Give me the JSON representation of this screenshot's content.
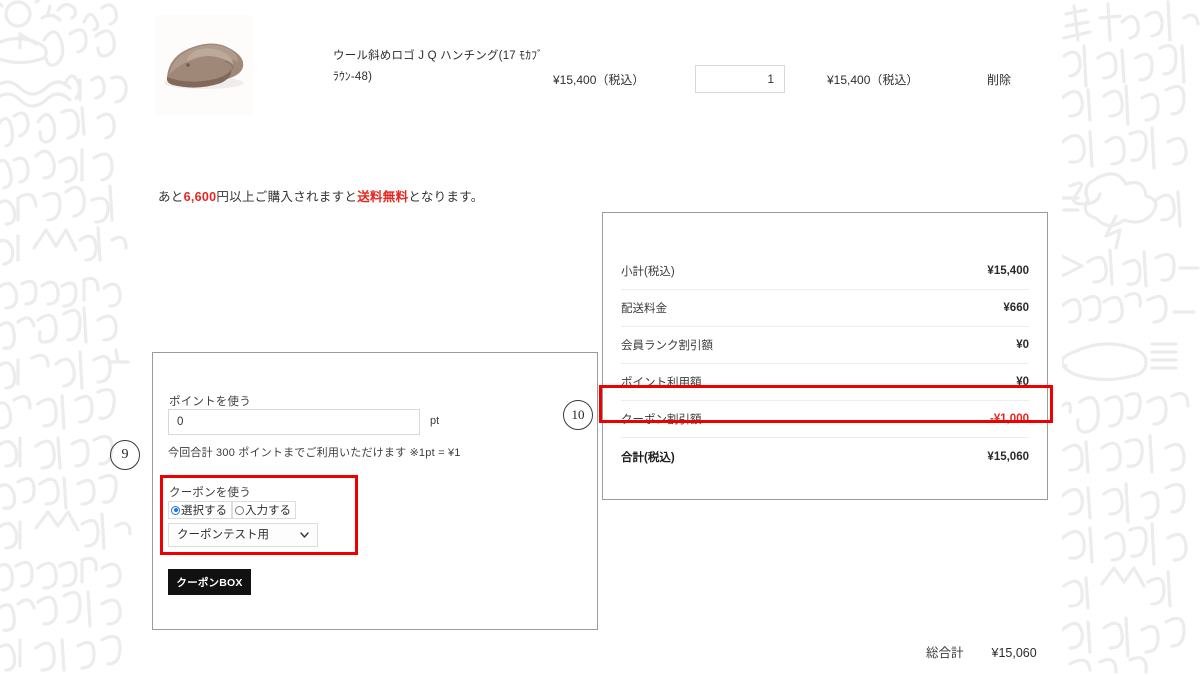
{
  "cart_item": {
    "thumb_alt": "product-thumbnail-hunting-cap",
    "name": "ウール斜めロゴ J Q ハンチング(17 ﾓｶﾌﾞﾗｳﾝ-48)",
    "unit_price": "¥15,400（税込）",
    "quantity": "1",
    "subtotal": "¥15,400（税込）",
    "delete_label": "削除"
  },
  "shipping_notice": {
    "prefix": "あと",
    "amount": "6,600",
    "middle": "円以上ご購入されますと",
    "free_shipping": "送料無料",
    "suffix": "となります。"
  },
  "summary": {
    "rows": [
      {
        "label": "小計(税込)",
        "value": "¥15,400",
        "highlight": false
      },
      {
        "label": "配送料金",
        "value": "¥660",
        "highlight": false
      },
      {
        "label": "会員ランク割引額",
        "value": "¥0",
        "highlight": false
      },
      {
        "label": "ポイント利用額",
        "value": "¥0",
        "highlight": false
      },
      {
        "label": "クーポン割引額",
        "value": "-¥1,000",
        "highlight": true
      },
      {
        "label": "合計(税込)",
        "value": "¥15,060",
        "highlight": false
      }
    ]
  },
  "points_panel": {
    "points_label": "ポイントを使う",
    "points_value": "0",
    "points_placeholder": "0",
    "points_unit": "pt",
    "points_note": "今回合計 300 ポイントまでご利用いただけます ※1pt = ¥1",
    "coupon_label": "クーポンを使う",
    "radio_select_label": "選択する",
    "radio_input_label": "入力する",
    "coupon_selected": "クーポンテスト用",
    "coupon_chevron": "❯",
    "coupon_box_button": "クーポンBOX"
  },
  "markers": {
    "step_nine": "9",
    "step_ten": "10"
  },
  "grand_total": {
    "label": "総合計",
    "value": "¥15,060"
  },
  "colors": {
    "accent_red": "#ef0000",
    "notice_red": "#e8251f",
    "button_black": "#111111",
    "radio_blue": "#1a73e8",
    "border_gray": "#9b9b9b"
  }
}
